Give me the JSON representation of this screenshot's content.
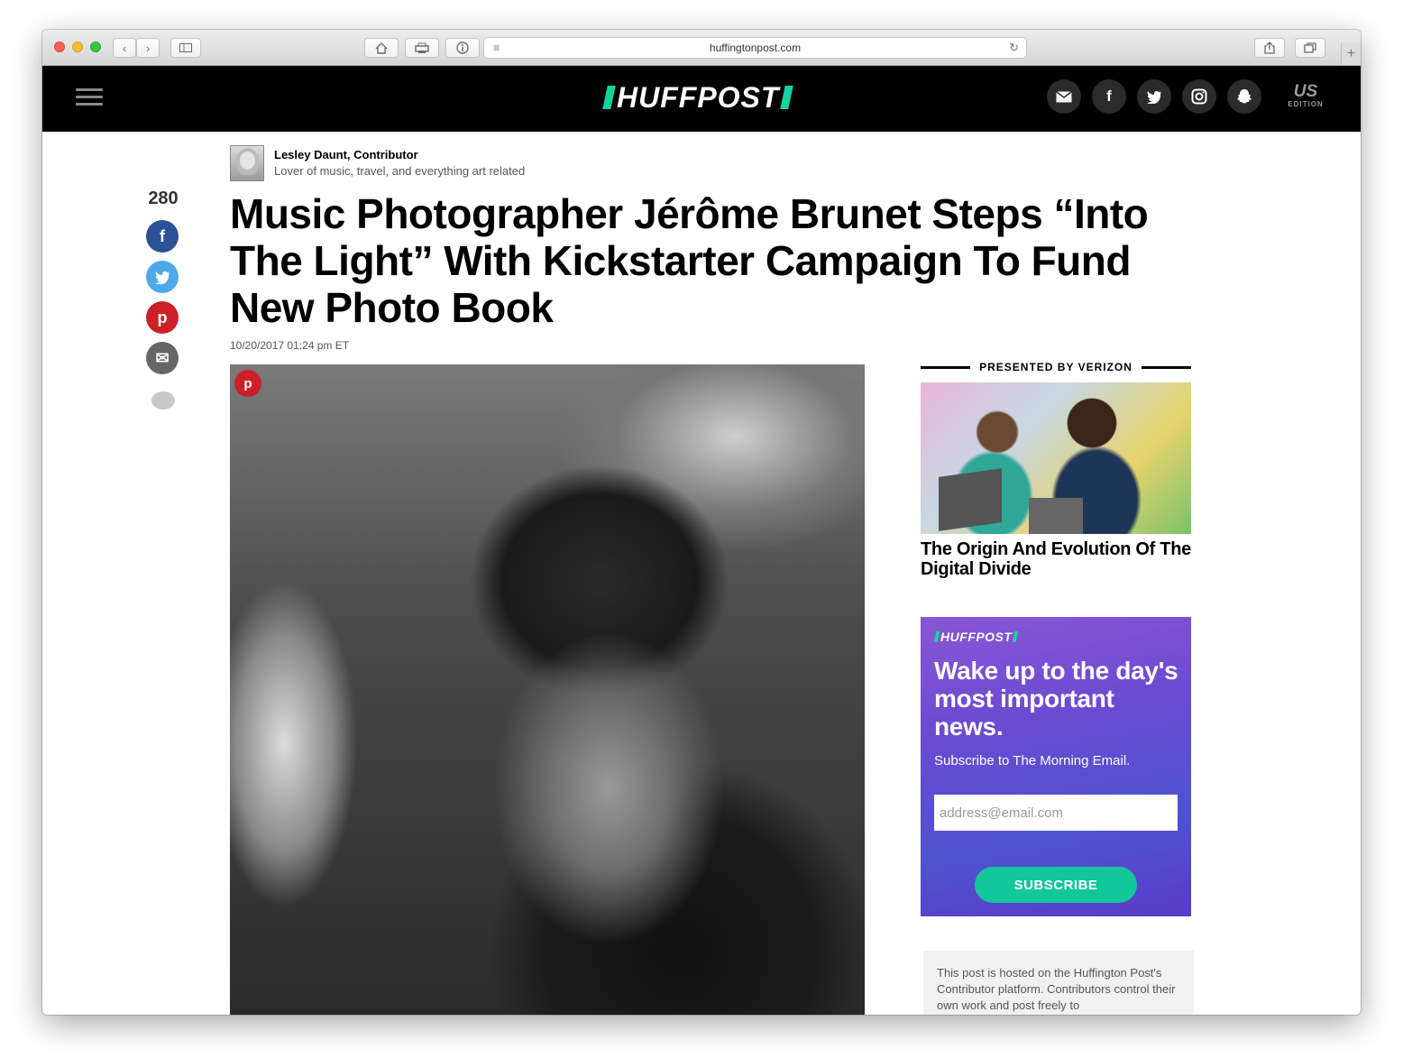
{
  "browser": {
    "url": "huffingtonpost.com",
    "new_tab": "+"
  },
  "site": {
    "logo": "HUFFPOST",
    "edition_top": "US",
    "edition_bottom": "EDITION",
    "accent": "#12d4a1"
  },
  "article": {
    "author_name": "Lesley Daunt, Contributor",
    "author_bio": "Lover of music, travel, and everything art related",
    "share_count": "280",
    "headline": "Music Photographer Jérôme Brunet Steps “Into The Light” With Kickstarter Campaign To Fund New Photo Book",
    "dateline": "10/20/2017 01:24 pm ET"
  },
  "sidebar": {
    "presented_by": "PRESENTED BY VERIZON",
    "promo_title": "The Origin And Evolution Of The Digital Divide",
    "newsletter": {
      "logo": "HUFFPOST",
      "headline": "Wake up to the day's most important news.",
      "subtitle": "Subscribe to The Morning Email.",
      "email_placeholder": "address@email.com",
      "button": "SUBSCRIBE"
    },
    "hosted_note": "This post is hosted on the Huffington Post's Contributor platform. Contributors control their own work and post freely to"
  },
  "icons": {
    "share_facebook": "f",
    "share_twitter": "t",
    "share_pinterest": "p",
    "share_email": "✉"
  }
}
